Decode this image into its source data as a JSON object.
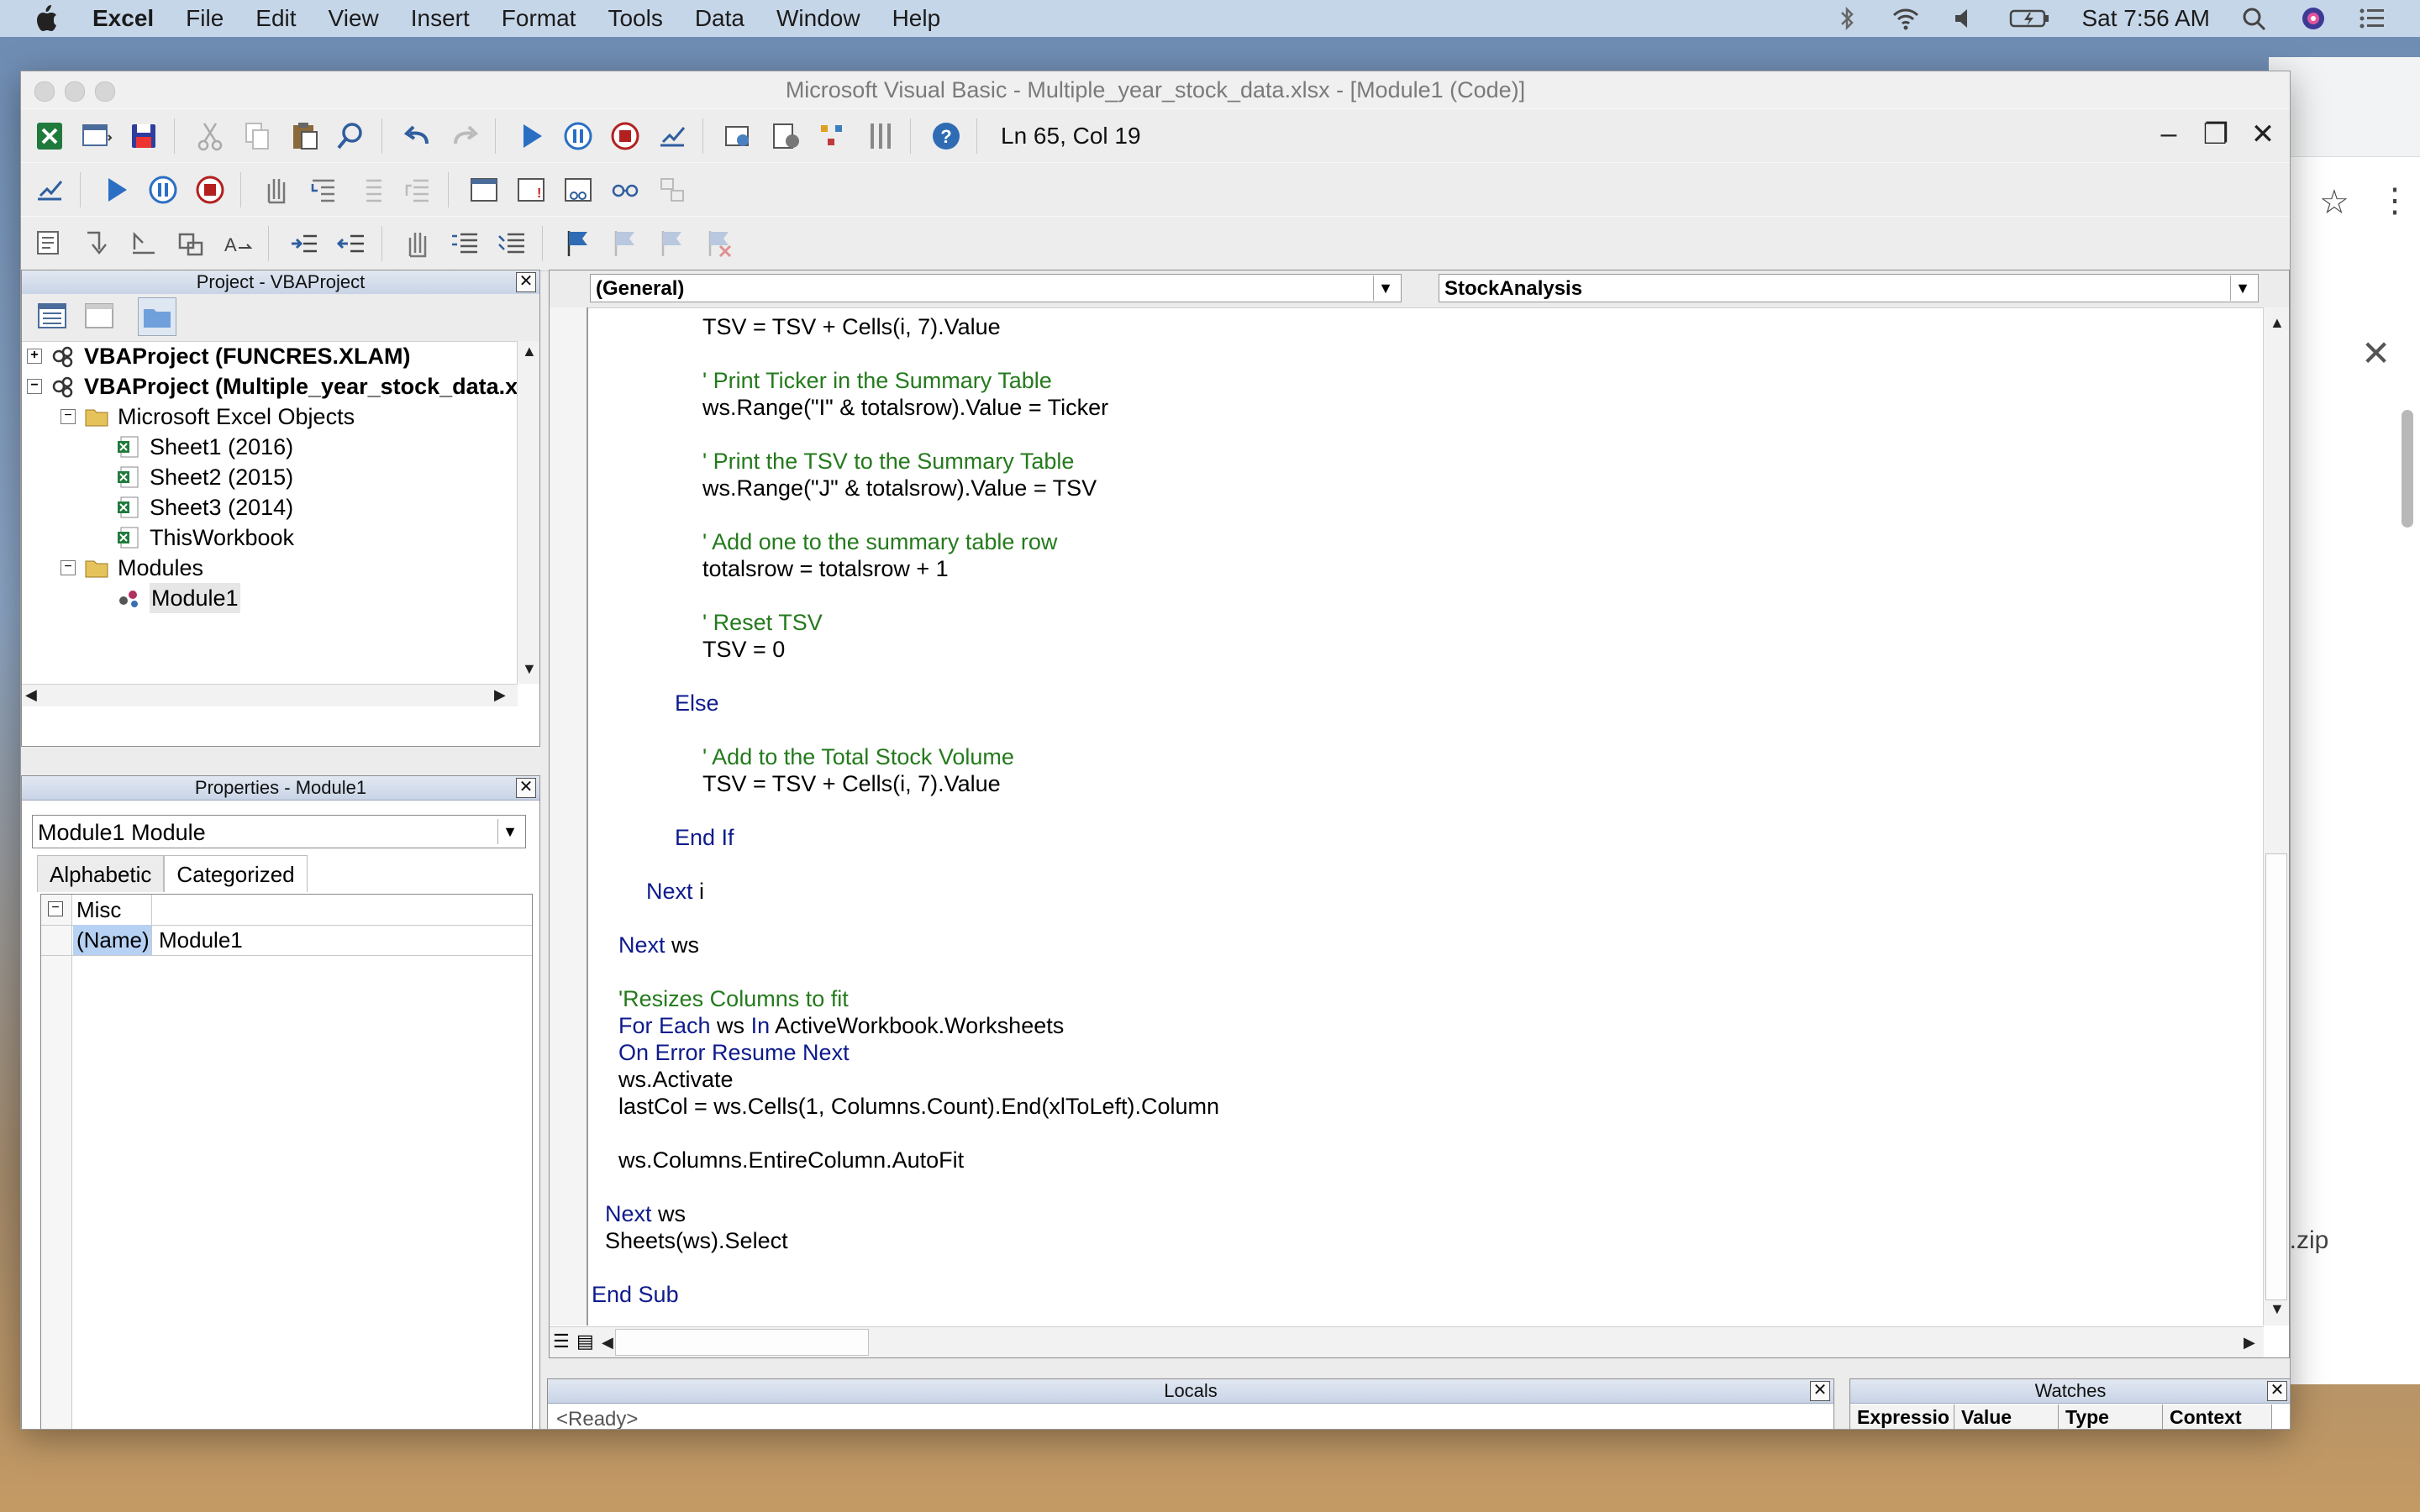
{
  "menubar": {
    "app": "Excel",
    "items": [
      "File",
      "Edit",
      "View",
      "Insert",
      "Format",
      "Tools",
      "Data",
      "Window",
      "Help"
    ],
    "clock": "Sat 7:56 AM",
    "battery_icon": "battery-charging-icon"
  },
  "background_window": {
    "partial_filename": "l.zip"
  },
  "vbe": {
    "title": "Microsoft Visual Basic - Multiple_year_stock_data.xlsx - [Module1 (Code)]",
    "status": "Ln 65, Col 19"
  },
  "project_pane": {
    "title": "Project - VBAProject",
    "nodes": [
      {
        "label": "VBAProject (FUNCRES.XLAM)",
        "bold": true,
        "icon": "vba-project-icon",
        "expander": "+"
      },
      {
        "label": "VBAProject (Multiple_year_stock_data.xl",
        "bold": true,
        "icon": "vba-project-icon",
        "expander": "-"
      },
      {
        "label": "Microsoft Excel Objects",
        "bold": false,
        "icon": "folder-icon",
        "expander": "-"
      },
      {
        "label": "Sheet1 (2016)",
        "bold": false,
        "icon": "excel-sheet-icon"
      },
      {
        "label": "Sheet2 (2015)",
        "bold": false,
        "icon": "excel-sheet-icon"
      },
      {
        "label": "Sheet3 (2014)",
        "bold": false,
        "icon": "excel-sheet-icon"
      },
      {
        "label": "ThisWorkbook",
        "bold": false,
        "icon": "excel-sheet-icon"
      },
      {
        "label": "Modules",
        "bold": false,
        "icon": "folder-icon",
        "expander": "-"
      },
      {
        "label": "Module1",
        "bold": false,
        "icon": "module-icon",
        "selected": true
      }
    ]
  },
  "properties_pane": {
    "title": "Properties - Module1",
    "object": "Module1 Module",
    "tabs": [
      "Alphabetic",
      "Categorized"
    ],
    "active_tab": "Categorized",
    "rows": [
      {
        "name": "Misc",
        "value": ""
      },
      {
        "name": "(Name)",
        "value": "Module1"
      }
    ]
  },
  "code_window": {
    "object_combo": "(General)",
    "proc_combo": "StockAnalysis",
    "lines": [
      [
        {
          "t": "TSV = TSV + Cells(i, 7).Value",
          "c": "n"
        }
      ],
      [
        {
          "t": "' Print Ticker in the Summary Table",
          "c": "cm"
        }
      ],
      [
        {
          "t": "ws.Range(\"I\" & totalsrow).Value = Ticker",
          "c": "n"
        }
      ],
      [
        {
          "t": "' Print the TSV to the Summary Table",
          "c": "cm"
        }
      ],
      [
        {
          "t": "ws.Range(\"J\" & totalsrow).Value = TSV",
          "c": "n"
        }
      ],
      [
        {
          "t": "' Add one to the summary table row",
          "c": "cm"
        }
      ],
      [
        {
          "t": "totalsrow = totalsrow + 1",
          "c": "n"
        }
      ],
      [
        {
          "t": "' Reset TSV",
          "c": "cm"
        }
      ],
      [
        {
          "t": "TSV = 0",
          "c": "n"
        }
      ],
      [
        {
          "t": "Else",
          "c": "kw"
        }
      ],
      [
        {
          "t": "' Add to the Total Stock Volume",
          "c": "cm"
        }
      ],
      [
        {
          "t": "TSV = TSV + Cells(i, 7).Value",
          "c": "n"
        }
      ],
      [
        {
          "t": "End If",
          "c": "kw"
        }
      ],
      [
        {
          "t": "Next",
          "c": "kw"
        },
        {
          "t": " i",
          "c": "n"
        }
      ],
      [
        {
          "t": "Next",
          "c": "kw"
        },
        {
          "t": " ws",
          "c": "n"
        }
      ],
      [
        {
          "t": "'Resizes Columns to fit",
          "c": "cm"
        }
      ],
      [
        {
          "t": "For Each",
          "c": "kw"
        },
        {
          "t": " ws ",
          "c": "n"
        },
        {
          "t": "In",
          "c": "kw"
        },
        {
          "t": " ActiveWorkbook.Worksheets",
          "c": "n"
        }
      ],
      [
        {
          "t": "On Error Resume Next",
          "c": "kw"
        }
      ],
      [
        {
          "t": "ws.Activate",
          "c": "n"
        }
      ],
      [
        {
          "t": "lastCol = ws.Cells(1, Columns.Count).End(xlToLeft).Column",
          "c": "n"
        }
      ],
      [
        {
          "t": "ws.Columns.EntireColumn.AutoFit",
          "c": "n"
        }
      ],
      [
        {
          "t": "Next",
          "c": "kw"
        },
        {
          "t": " ws",
          "c": "n"
        }
      ],
      [
        {
          "t": "Sheets(ws).Select",
          "c": "n"
        }
      ],
      [
        {
          "t": "End Sub",
          "c": "kw"
        }
      ]
    ]
  },
  "locals_pane": {
    "title": "Locals",
    "status": "<Ready>"
  },
  "watches_pane": {
    "title": "Watches",
    "columns": [
      "Expressio",
      "Value",
      "Type",
      "Context"
    ]
  }
}
